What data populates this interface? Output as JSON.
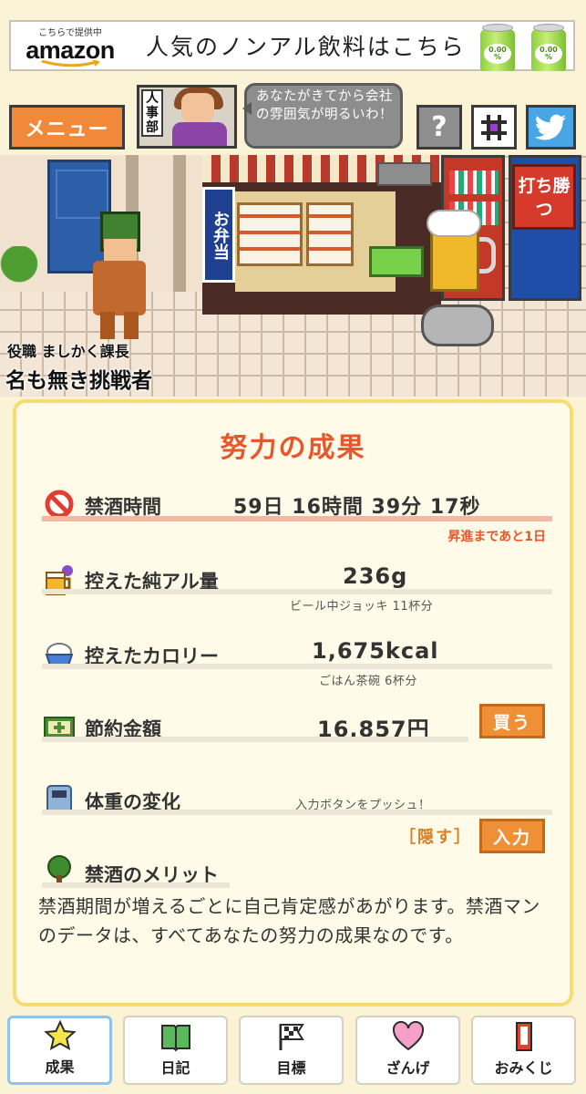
{
  "ad": {
    "provider": "こちらで提供中",
    "brand": "amazon",
    "text": "人気のノンアル飲料はこちら",
    "can_label": "0.00 %"
  },
  "header": {
    "menu_label": "メニュー",
    "hr_badge": "人事部",
    "speech": "あなたがきてから会社の雰囲気が明るいわ！",
    "help_label": "?"
  },
  "scene": {
    "shop_sign": "お弁当",
    "title_line": "役職 ましかく課長",
    "name": "名も無き挑戦者",
    "fight_label": "打ち勝つ"
  },
  "results": {
    "title": "努力の成果",
    "abstinence": {
      "label": "禁酒時間",
      "value": "59日 16時間 39分 17秒",
      "promotion": "昇進まであと1日"
    },
    "alcohol": {
      "label": "控えた純アル量",
      "value": "236g",
      "sub": "ビール中ジョッキ 11杯分"
    },
    "calories": {
      "label": "控えたカロリー",
      "value": "1,675kcal",
      "sub": "ごはん茶碗 6杯分"
    },
    "savings": {
      "label": "節約金額",
      "value": "16,857円",
      "buy_label": "買う"
    },
    "weight": {
      "label": "体重の変化",
      "prompt": "入力ボタンをプッシュ！",
      "hide_label": "［隠す］",
      "input_label": "入力"
    },
    "merit": {
      "label": "禁酒のメリット",
      "text": "禁酒期間が増えるごとに自己肯定感があがります。禁酒マンのデータは、すべてあなたの努力の成果なのです。"
    }
  },
  "nav": {
    "items": [
      {
        "label": "成果",
        "icon": "star-icon"
      },
      {
        "label": "日記",
        "icon": "book-icon"
      },
      {
        "label": "目標",
        "icon": "flag-icon"
      },
      {
        "label": "ざんげ",
        "icon": "heart-icon"
      },
      {
        "label": "おみくじ",
        "icon": "omikuji-icon"
      }
    ],
    "active_index": 0
  },
  "colors": {
    "accent_orange": "#f08a3a",
    "title_red": "#e8572b",
    "card_border": "#f6dc73",
    "twitter_blue": "#49a6e6"
  }
}
